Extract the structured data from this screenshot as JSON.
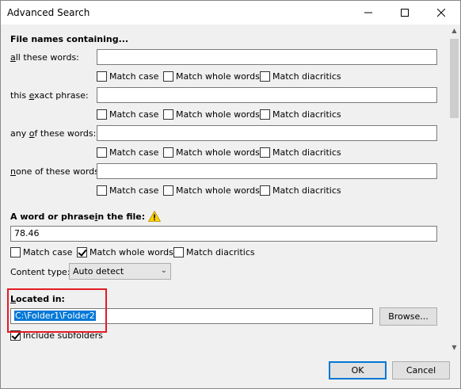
{
  "window": {
    "title": "Advanced Search",
    "minimize_icon": "minimize-icon",
    "maximize_icon": "maximize-icon",
    "close_icon": "close-icon"
  },
  "filenames": {
    "heading": "File names containing...",
    "rows": [
      {
        "label_pre": "",
        "label_u": "a",
        "label_post": "ll these words:",
        "value": ""
      },
      {
        "label_pre": "this ",
        "label_u": "e",
        "label_post": "xact phrase:",
        "value": ""
      },
      {
        "label_pre": "any ",
        "label_u": "o",
        "label_post": "f these words:",
        "value": ""
      },
      {
        "label_pre": "",
        "label_u": "n",
        "label_post": "one of these words:",
        "value": ""
      }
    ],
    "match_case": "Match case",
    "match_whole_words": "Match whole words",
    "match_diacritics": "Match diacritics"
  },
  "content": {
    "heading_pre": "A word or phrase ",
    "heading_u": "i",
    "heading_post": "n the file:",
    "warning_icon": "warning-icon",
    "value": "78.46",
    "match_case": "Match case",
    "match_whole_words": "Match whole words",
    "match_diacritics": "Match diacritics",
    "match_case_checked": false,
    "match_whole_words_checked": true,
    "match_diacritics_checked": false,
    "type_label": "Content type:",
    "type_value": "Auto detect"
  },
  "location": {
    "heading_u": "L",
    "heading_post": "ocated in:",
    "value": "C:\\Folder1\\Folder2",
    "browse": "Browse...",
    "include_subfolders": "Include subfolders",
    "include_subfolders_checked": true
  },
  "footer": {
    "ok": "OK",
    "cancel": "Cancel"
  },
  "colors": {
    "highlight": "#e31b23",
    "selection": "#0078d7"
  }
}
